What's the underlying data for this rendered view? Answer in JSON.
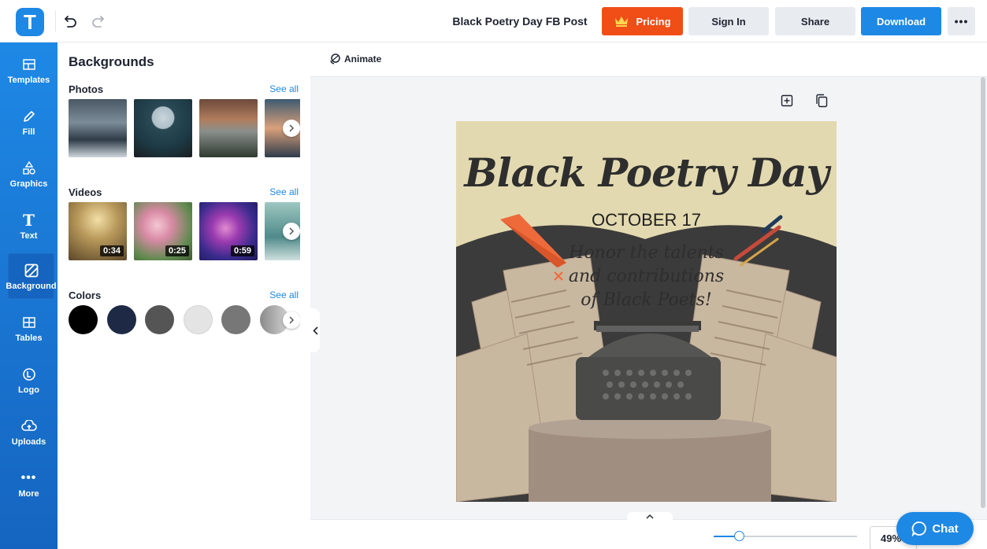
{
  "app": {
    "logo_letter": "T"
  },
  "header": {
    "doc_title": "Black Poetry Day FB Post",
    "pricing_label": "Pricing",
    "signin_label": "Sign In",
    "share_label": "Share",
    "download_label": "Download",
    "more_label": "•••"
  },
  "nav": {
    "items": [
      {
        "label": "Templates",
        "icon": "templates-icon"
      },
      {
        "label": "Fill",
        "icon": "fill-icon"
      },
      {
        "label": "Graphics",
        "icon": "graphics-icon"
      },
      {
        "label": "Text",
        "icon": "text-icon"
      },
      {
        "label": "Background",
        "icon": "background-icon",
        "active": true
      },
      {
        "label": "Tables",
        "icon": "tables-icon"
      },
      {
        "label": "Logo",
        "icon": "logo-icon"
      },
      {
        "label": "Uploads",
        "icon": "uploads-icon"
      },
      {
        "label": "More",
        "icon": "more-icon"
      }
    ]
  },
  "panel": {
    "title": "Backgrounds",
    "photos": {
      "title": "Photos",
      "see_all": "See all"
    },
    "videos": {
      "title": "Videos",
      "see_all": "See all",
      "durations": [
        "0:34",
        "0:25",
        "0:59"
      ]
    },
    "colors": {
      "title": "Colors",
      "see_all": "See all",
      "swatches": [
        "#000000",
        "#1e2a45",
        "#555555",
        "#e4e4e4",
        "#777777",
        "#a8a8a8"
      ]
    }
  },
  "workspace": {
    "animate_label": "Animate",
    "zoom_value": "49%",
    "chat_label": "Chat"
  },
  "canvas": {
    "title": "Black Poetry Day",
    "date": "OCTOBER 17",
    "tagline": [
      "Honor the talents",
      "and contributions",
      "of Black Poets!"
    ]
  },
  "colors": {
    "accent": "#1e88e5",
    "pricing": "#f04e17",
    "canvas_bg": "#e3d9b0"
  }
}
